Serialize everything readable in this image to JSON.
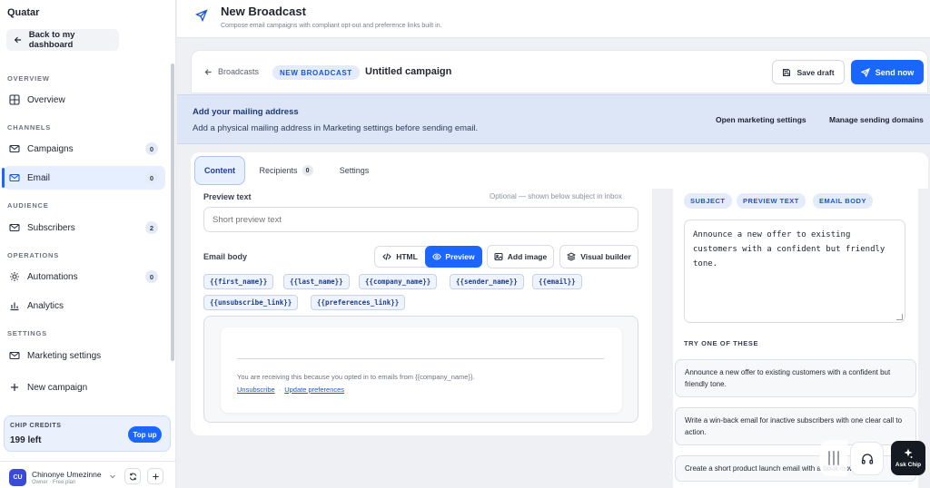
{
  "sidebar": {
    "workspace_name": "Quatar",
    "back_label": "Back to my dashboard",
    "sections": {
      "overview": "OVERVIEW",
      "channels": "CHANNELS",
      "audience": "AUDIENCE",
      "operations": "OPERATIONS",
      "settings": "SETTINGS"
    },
    "items": {
      "overview": {
        "label": "Overview"
      },
      "campaigns": {
        "label": "Campaigns",
        "count": "0"
      },
      "email": {
        "label": "Email",
        "count": "0"
      },
      "subscribers": {
        "label": "Subscribers",
        "count": "2"
      },
      "automations": {
        "label": "Automations",
        "count": "0"
      },
      "analytics": {
        "label": "Analytics"
      },
      "marketing_settings": {
        "label": "Marketing settings"
      },
      "new_campaign": {
        "label": "New campaign"
      }
    },
    "credits": {
      "label": "CHIP CREDITS",
      "value": "199 left",
      "topup_label": "Top up"
    },
    "user": {
      "initials": "CU",
      "name": "Chinonye Umezinne",
      "role": "Owner · Free plan"
    }
  },
  "header": {
    "title": "New Broadcast",
    "subtitle": "Compose email campaigns with compliant opt-out and preference links built in."
  },
  "topbar": {
    "breadcrumb": "Broadcasts",
    "badge": "NEW BROADCAST",
    "campaign_title": "Untitled campaign",
    "save_draft_label": "Save draft",
    "send_now_label": "Send now"
  },
  "banner": {
    "title": "Add your mailing address",
    "description": "Add a physical mailing address in Marketing settings before sending email.",
    "link_marketing": "Open marketing settings",
    "link_domains": "Manage sending domains"
  },
  "tabs": {
    "content": "Content",
    "recipients": "Recipients",
    "recipients_count": "0",
    "settings": "Settings"
  },
  "editor": {
    "preview_label": "Preview text",
    "preview_hint": "Optional — shown below subject in inbox",
    "preview_placeholder": "Short preview text",
    "body_label": "Email body",
    "mode_html": "HTML",
    "mode_preview": "Preview",
    "add_image_label": "Add image",
    "visual_builder_label": "Visual builder",
    "tokens": [
      "{{first_name}}",
      "{{last_name}}",
      "{{company_name}}",
      "{{sender_name}}",
      "{{email}}",
      "{{unsubscribe_link}}",
      "{{preferences_link}}"
    ],
    "footer_text": "You are receiving this because you opted in to emails from {{company_name}}.",
    "unsubscribe_label": "Unsubscribe",
    "separator": "·",
    "preferences_label": "Update preferences"
  },
  "assistant": {
    "tags": [
      "SUBJECT",
      "PREVIEW TEXT",
      "EMAIL BODY"
    ],
    "prompt_text": "Announce a new offer to existing customers with a confident but friendly tone.",
    "try_label": "TRY ONE OF THESE",
    "suggestions": [
      "Announce a new offer to existing customers with a confident but friendly tone.",
      "Write a win-back email for inactive subscribers with one clear call to action.",
      "Create a short product launch email with a book-now CTA."
    ]
  },
  "floating": {
    "ask_label": "Ask Chip"
  },
  "colors": {
    "accent": "#1a66ff",
    "banner_bg": "#dde6f7",
    "badge_bg": "#e4ecfb"
  }
}
